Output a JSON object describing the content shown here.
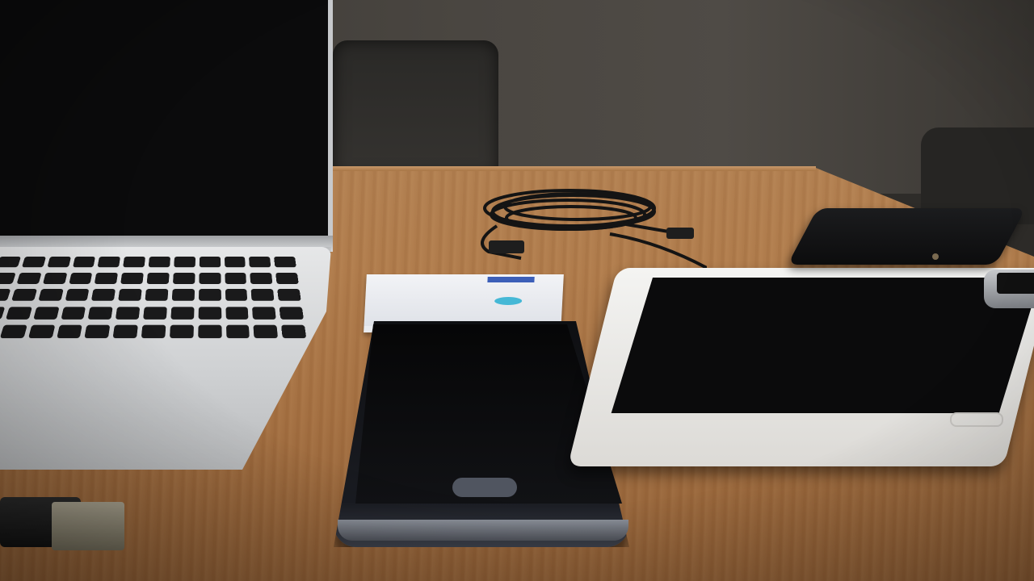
{
  "scene": {
    "palette": {
      "wall": "#4a4641",
      "table": "#b07c4c",
      "laptop": "#d3d5d7",
      "device_black": "#0c0c0d",
      "tablet_white": "#eeeeec",
      "card_blue": "#3c5fb8"
    },
    "objects": [
      "laptop",
      "coiled-cable",
      "business-cards",
      "smartphone",
      "tablet",
      "power-bank",
      "small-phone",
      "usb-stick",
      "chair"
    ]
  }
}
